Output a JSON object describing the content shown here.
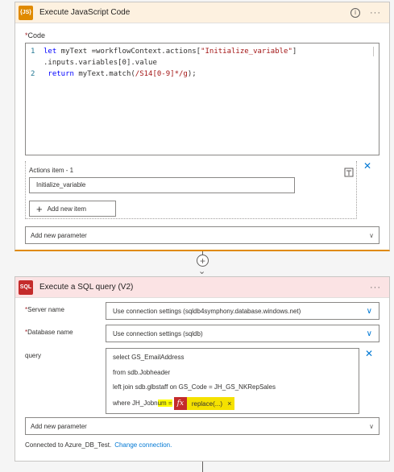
{
  "js_card": {
    "icon_label": "{JS}",
    "title": "Execute JavaScript Code",
    "info_icon": "i",
    "menu": "···",
    "code_label": "Code",
    "required_mark": "*",
    "code_lines": [
      {
        "num": "1",
        "text_kw": "let",
        "text_a": " myText =workflowContext.actions[",
        "text_str": "\"Initialize_variable\"",
        "text_b": "]"
      },
      {
        "cont": ".inputs.variables[0].value"
      },
      {
        "num": "2",
        "text_kw": "return",
        "text_a": " myText.match(",
        "text_str": "/S14[0-9]*/g",
        "text_b": ");"
      }
    ],
    "actions_label": "Actions item - 1",
    "action_value": "Initialize_variable",
    "add_item_label": "Add new item",
    "add_param_label": "Add new parameter"
  },
  "sql_card": {
    "icon_label": "SQL",
    "title": "Execute a SQL query (V2)",
    "menu": "···",
    "server_label": "Server name",
    "server_value": "Use connection settings (sqldb4symphony.database.windows.net)",
    "db_label": "Database name",
    "db_value": "Use connection settings (sqldb)",
    "query_label": "query",
    "query_lines": [
      "select GS_EmailAddress",
      "from sdb.Jobheader",
      "left join sdb.glbstaff on GS_Code = JH_GS_NKRepSales"
    ],
    "where_prefix": "where JH_Jobn",
    "where_highlight": "um =",
    "fx_symbol": "fx",
    "fx_text": "replace(...)",
    "fx_close": "×",
    "add_param_label": "Add new parameter",
    "connection_text": "Connected to Azure_DB_Test.",
    "change_link": "Change connection."
  }
}
